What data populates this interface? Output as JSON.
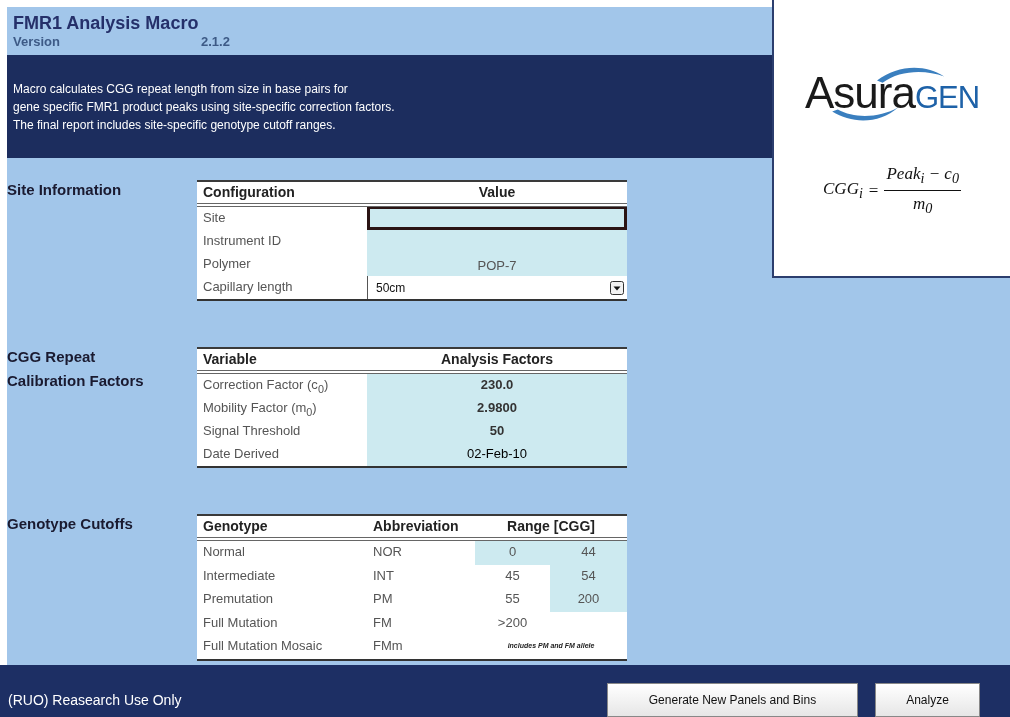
{
  "header": {
    "title": "FMR1 Analysis Macro",
    "version_label": "Version",
    "version": "2.1.2"
  },
  "description": [
    "Macro calculates CGG repeat length from size in base pairs for",
    "gene specific FMR1 product peaks using site-specific correction factors.",
    "The final report includes site-specific genotype cutoff ranges."
  ],
  "logo": {
    "part_1": "Asura",
    "part_2": "gen"
  },
  "formula": {
    "lhs": "CGG$_{i}$",
    "equals": "=",
    "numerator": "Peak$_{i}$ − c$_{0}$",
    "denominator": "m$_{0}$"
  },
  "site_information": {
    "label": "Site Information",
    "columns": [
      "Configuration",
      "Value"
    ],
    "rows": [
      {
        "name": "Site",
        "kind": "field",
        "active": true
      },
      {
        "name": "Instrument ID",
        "kind": "field",
        "active": false
      },
      {
        "name": "Polymer",
        "kind": "field",
        "value": "POP-7",
        "active": false
      },
      {
        "name": "Capillary length",
        "kind": "dropdown",
        "value": "50cm",
        "active": false
      }
    ]
  },
  "calibration": {
    "label_lines": [
      "CGG Repeat",
      "Calibration Factors"
    ],
    "columns": [
      "Variable",
      "Analysis Factors"
    ],
    "rows": [
      {
        "name": "Correction Factor (c$_{0}$)",
        "value": "230.0",
        "bold": true
      },
      {
        "name": "Mobility Factor (m$_{0}$)",
        "value": "2.9800",
        "bold": true
      },
      {
        "name": "Signal Threshold",
        "value": "50",
        "bold": true
      },
      {
        "name": "Date Derived",
        "value": "02-Feb-10",
        "bold": false
      }
    ]
  },
  "genotype_cutoffs": {
    "label": "Genotype Cutoffs",
    "columns": [
      "Genotype",
      "Abbreviation",
      "Range [CGG]"
    ],
    "rows": [
      {
        "genotype": "Normal",
        "abbreviation": "NOR",
        "kind": "range",
        "low": {
          "value": "0",
          "highlighted": true
        },
        "high": {
          "value": "44",
          "highlighted": true
        }
      },
      {
        "genotype": "Intermediate",
        "abbreviation": "INT",
        "kind": "range",
        "low": {
          "value": "45",
          "highlighted": false
        },
        "high": {
          "value": "54",
          "highlighted": true
        }
      },
      {
        "genotype": "Premutation",
        "abbreviation": "PM",
        "kind": "range",
        "low": {
          "value": "55",
          "highlighted": false
        },
        "high": {
          "value": "200",
          "highlighted": true
        }
      },
      {
        "genotype": "Full Mutation",
        "abbreviation": "FM",
        "kind": "single",
        "range": ">200"
      },
      {
        "genotype": "Full Mutation Mosaic",
        "abbreviation": "FMm",
        "kind": "note",
        "range": "includes PM and FM allele"
      }
    ]
  },
  "footer": {
    "note": "(RUO) Reasearch Use Only",
    "buttons": [
      "Generate New Panels and Bins",
      "Analyze"
    ]
  }
}
